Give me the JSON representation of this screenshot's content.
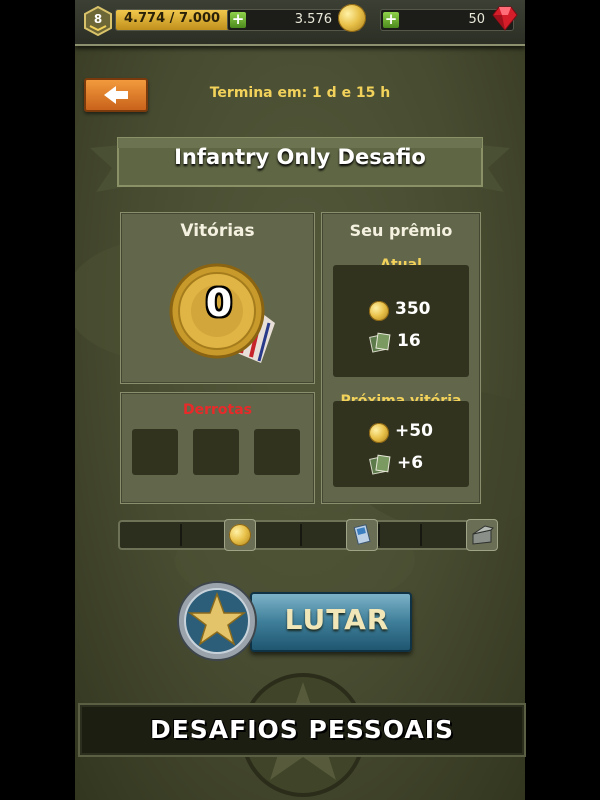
{
  "topbar": {
    "rank_level": "8",
    "xp_current": "4.774",
    "xp_total": "7.000",
    "xp_progress": 0.68,
    "coins": "3.576",
    "gems": "50"
  },
  "header": {
    "timer": "Termina em: 1 d e 15 h",
    "title": "Infantry Only Desafio"
  },
  "wins": {
    "label": "Vitórias",
    "count": "0"
  },
  "losses": {
    "label": "Derrotas",
    "slots": 3
  },
  "prize": {
    "label": "Seu prêmio",
    "current_label": "Atual",
    "current_coins": "350",
    "current_cards": "16",
    "next_label": "Próxima vitória",
    "next_coins": "+50",
    "next_cards": "+6"
  },
  "fight_button": {
    "label": "LUTAR"
  },
  "banner": {
    "label": "DESAFIOS PESSOAIS"
  },
  "colors": {
    "accent_gold": "#f2d25a",
    "loss_red": "#e82a2a",
    "fight_blue": "#3f7e99",
    "back_orange": "#e07e2a"
  }
}
